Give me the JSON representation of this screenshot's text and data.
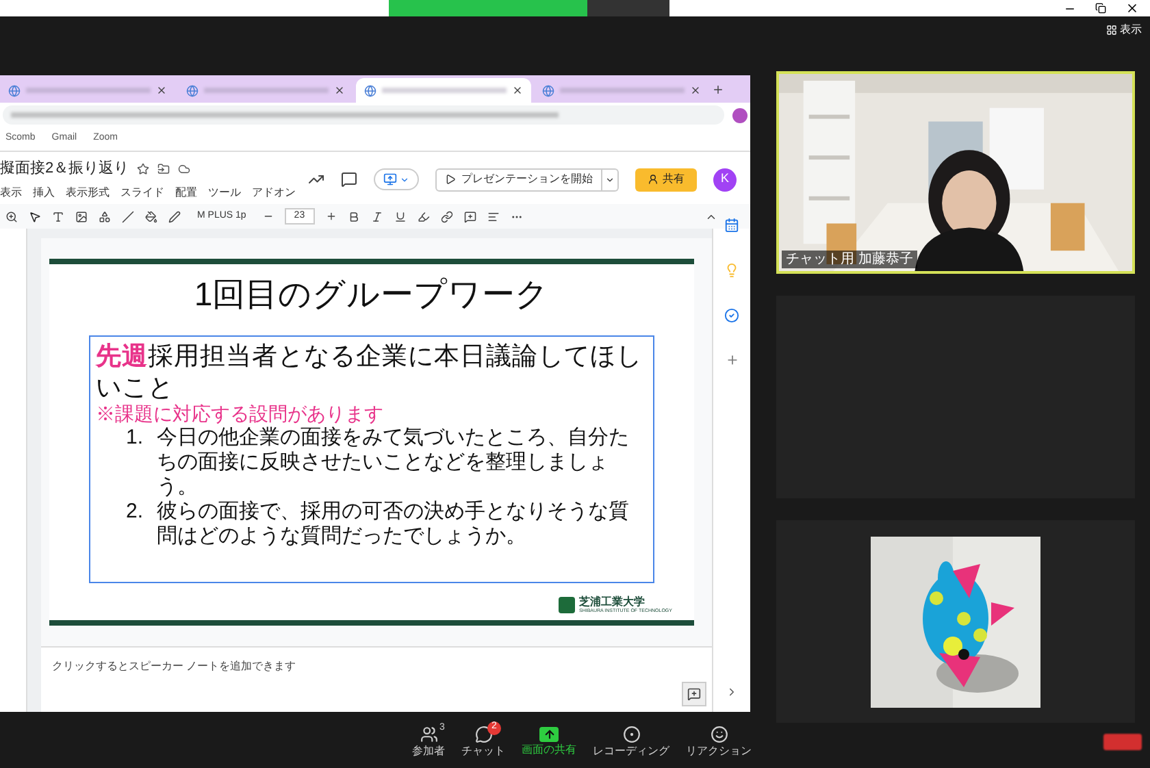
{
  "zoom": {
    "view_button": "表示"
  },
  "browser": {
    "tabs": [
      {
        "selected": false
      },
      {
        "selected": false
      },
      {
        "selected": true
      },
      {
        "selected": false
      }
    ],
    "bookmarks": [
      "Scomb",
      "Gmail",
      "Zoom"
    ]
  },
  "slides_app": {
    "doc_title": "擬面接2＆振り返り",
    "menu": [
      "表示",
      "挿入",
      "表示形式",
      "スライド",
      "配置",
      "ツール",
      "アドオン"
    ],
    "present_button": "プレゼンテーションを開始",
    "share_button": "共有",
    "account_initial": "K",
    "font": "M PLUS 1p",
    "font_size": "23"
  },
  "slide": {
    "title": "1回目のグループワーク",
    "lead": "**先週**採用担当者となる企業に本日議論してほしいこと",
    "note": "※課題に対応する設問があります",
    "items": [
      {
        "number": "1.",
        "text": "今日の他企業の面接をみて気づいたところ、自分たちの面接に反映させたいことなどを整理しましょう。"
      },
      {
        "number": "2.",
        "text": "彼らの面接で、採用の可否の決め手となりそうな質問はどのような質問だったでしょうか。"
      }
    ],
    "logo_name": "芝浦工業大学",
    "logo_subtitle": "SHIBAURA INSTITUTE OF TECHNOLOGY"
  },
  "speaker_notes": {
    "placeholder": "クリックするとスピーカー ノートを追加できます"
  },
  "participants": [
    {
      "kind": "video",
      "name": "チャット用 加藤恭子",
      "speaking": true
    },
    {
      "kind": "blank",
      "speaking": false
    },
    {
      "kind": "picture",
      "speaking": false
    }
  ],
  "toolbar": [
    {
      "kind": "participants",
      "label": "参加者",
      "badge": "3",
      "active": false
    },
    {
      "kind": "chat",
      "label": "チャット",
      "badge": "2",
      "active": false
    },
    {
      "kind": "share",
      "label": "画面の共有",
      "active": true
    },
    {
      "kind": "record",
      "label": "レコーディング",
      "active": false
    },
    {
      "kind": "reaction",
      "label": "リアクション",
      "active": false
    }
  ]
}
